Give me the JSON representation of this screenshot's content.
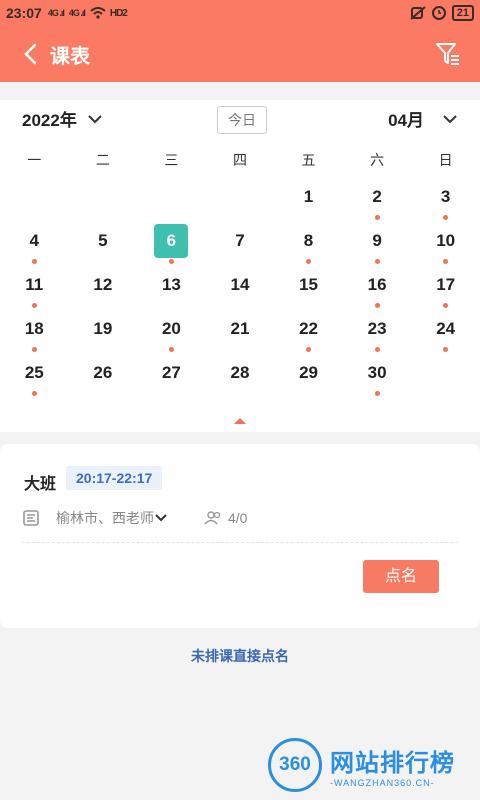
{
  "status_bar": {
    "time": "23:07",
    "signal1": "4G .ıl",
    "signal2": "4G .ıl",
    "wifi": "wifi",
    "hd": "HD2",
    "battery": "21"
  },
  "header": {
    "title": "课表"
  },
  "calendar": {
    "year": "2022年",
    "today_label": "今日",
    "month": "04月",
    "weekdays": [
      "一",
      "二",
      "三",
      "四",
      "五",
      "六",
      "日"
    ],
    "selected_day": "6",
    "accent": "#fa7a63",
    "selected_color": "#3fbfb0",
    "dot_color": "#f0735a",
    "days": [
      {
        "n": "",
        "dot": false
      },
      {
        "n": "",
        "dot": false
      },
      {
        "n": "",
        "dot": false
      },
      {
        "n": "",
        "dot": false
      },
      {
        "n": "1",
        "dot": false
      },
      {
        "n": "2",
        "dot": true
      },
      {
        "n": "3",
        "dot": true
      },
      {
        "n": "4",
        "dot": true
      },
      {
        "n": "5",
        "dot": false
      },
      {
        "n": "6",
        "dot": true
      },
      {
        "n": "7",
        "dot": false
      },
      {
        "n": "8",
        "dot": true
      },
      {
        "n": "9",
        "dot": true
      },
      {
        "n": "10",
        "dot": true
      },
      {
        "n": "11",
        "dot": true
      },
      {
        "n": "12",
        "dot": false
      },
      {
        "n": "13",
        "dot": false
      },
      {
        "n": "14",
        "dot": false
      },
      {
        "n": "15",
        "dot": false
      },
      {
        "n": "16",
        "dot": true
      },
      {
        "n": "17",
        "dot": true
      },
      {
        "n": "18",
        "dot": true
      },
      {
        "n": "19",
        "dot": false
      },
      {
        "n": "20",
        "dot": true
      },
      {
        "n": "21",
        "dot": false
      },
      {
        "n": "22",
        "dot": true
      },
      {
        "n": "23",
        "dot": true
      },
      {
        "n": "24",
        "dot": true
      },
      {
        "n": "25",
        "dot": true
      },
      {
        "n": "26",
        "dot": false
      },
      {
        "n": "27",
        "dot": false
      },
      {
        "n": "28",
        "dot": false
      },
      {
        "n": "29",
        "dot": false
      },
      {
        "n": "30",
        "dot": true
      },
      {
        "n": "",
        "dot": false
      }
    ]
  },
  "course": {
    "name": "大班",
    "time": "20:17-22:17",
    "teacher": "榆林市、西老师",
    "count": "4/0",
    "rollcall_label": "点名"
  },
  "direct_rollcall": "未排课直接点名",
  "watermark": {
    "logo": "360",
    "title": "网站排行榜",
    "sub": "-WANGZHAN360.CN-"
  }
}
